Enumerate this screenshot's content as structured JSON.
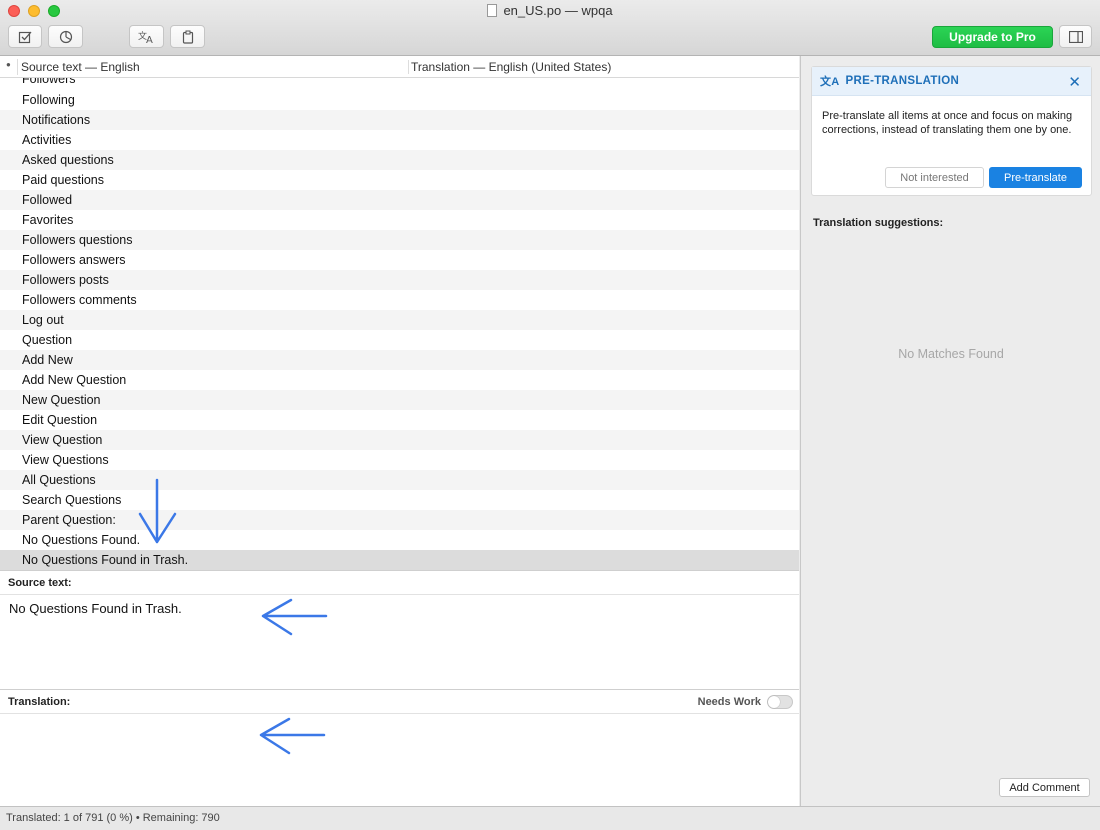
{
  "window": {
    "title": "en_US.po — wpqa"
  },
  "toolbar": {
    "validate_icon": "checkbox-icon",
    "stats_icon": "pie-chart-icon",
    "translate_icon": "translate-icon",
    "tm_icon": "clipboard-icon",
    "upgrade_label": "Upgrade to Pro",
    "sidebar_icon": "sidebar-toggle-icon"
  },
  "list": {
    "header_source": "Source text — English",
    "header_translation": "Translation — English (United States)",
    "partial_row": "Followers",
    "rows": [
      "Following",
      "Notifications",
      "Activities",
      "Asked questions",
      "Paid questions",
      "Followed",
      "Favorites",
      "Followers questions",
      "Followers answers",
      "Followers posts",
      "Followers comments",
      "Log out",
      "Question",
      "Add New",
      "Add New Question",
      "New Question",
      "Edit Question",
      "View Question",
      "View Questions",
      "All Questions",
      "Search Questions",
      "Parent Question:",
      "No Questions Found.",
      "No Questions Found in Trash."
    ],
    "selected_index": 23
  },
  "editor": {
    "source_label": "Source text:",
    "source_text": "No Questions Found in Trash.",
    "translation_label": "Translation:",
    "needs_work_label": "Needs Work",
    "translation_text": ""
  },
  "sidebar": {
    "pretranslation": {
      "title": "PRE-TRANSLATION",
      "description": "Pre-translate all items at once and focus on making corrections, instead of translating them one by one.",
      "not_interested_label": "Not interested",
      "pretranslate_label": "Pre-translate"
    },
    "suggestions_label": "Translation suggestions:",
    "no_matches": "No Matches Found",
    "add_comment_label": "Add Comment"
  },
  "status": {
    "text": "Translated: 1 of 791 (0 %)  •  Remaining: 790"
  },
  "colors": {
    "accent_blue": "#1a82e2",
    "upgrade_green": "#22c74a",
    "annotation_arrow": "#3b78e7"
  }
}
